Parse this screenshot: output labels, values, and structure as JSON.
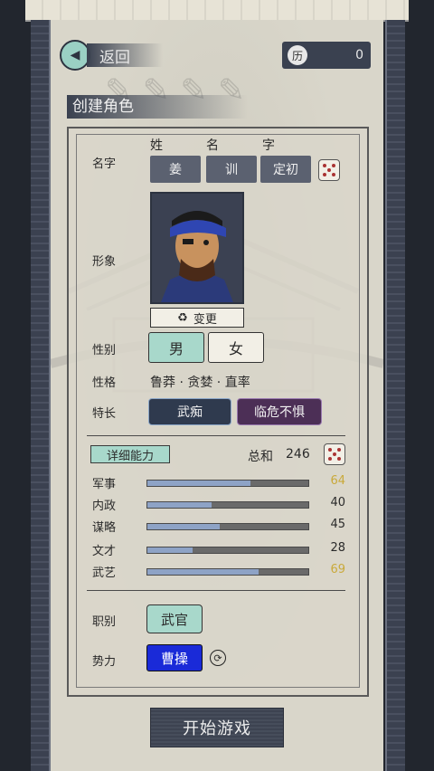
{
  "nav": {
    "back_label": "返回",
    "coin_icon": "历",
    "coin_value": "0"
  },
  "title": "创建角色",
  "name": {
    "label": "名字",
    "headers": [
      "姓",
      "名",
      "字"
    ],
    "values": [
      "姜",
      "训",
      "定初"
    ]
  },
  "appearance": {
    "label": "形象",
    "change_label": "变更"
  },
  "gender": {
    "label": "性别",
    "options": [
      "男",
      "女"
    ],
    "selected": "男"
  },
  "personality": {
    "label": "性格",
    "value": "鲁莽 · 贪婪 · 直率"
  },
  "traits": {
    "label": "特长",
    "items": [
      "武痴",
      "临危不惧"
    ]
  },
  "detail": {
    "button": "详细能力",
    "total_label": "总和",
    "total": "246",
    "stats": [
      {
        "name": "军事",
        "value": 64,
        "num_color": "#c9a93a"
      },
      {
        "name": "内政",
        "value": 40,
        "num_color": "#2a2a2a"
      },
      {
        "name": "谋略",
        "value": 45,
        "num_color": "#2a2a2a"
      },
      {
        "name": "文才",
        "value": 28,
        "num_color": "#2a2a2a"
      },
      {
        "name": "武艺",
        "value": 69,
        "num_color": "#c9a93a"
      }
    ]
  },
  "job": {
    "label": "职别",
    "value": "武官"
  },
  "faction": {
    "label": "势力",
    "value": "曹操",
    "color": "#1a2ad8"
  },
  "start_button": "开始游戏"
}
